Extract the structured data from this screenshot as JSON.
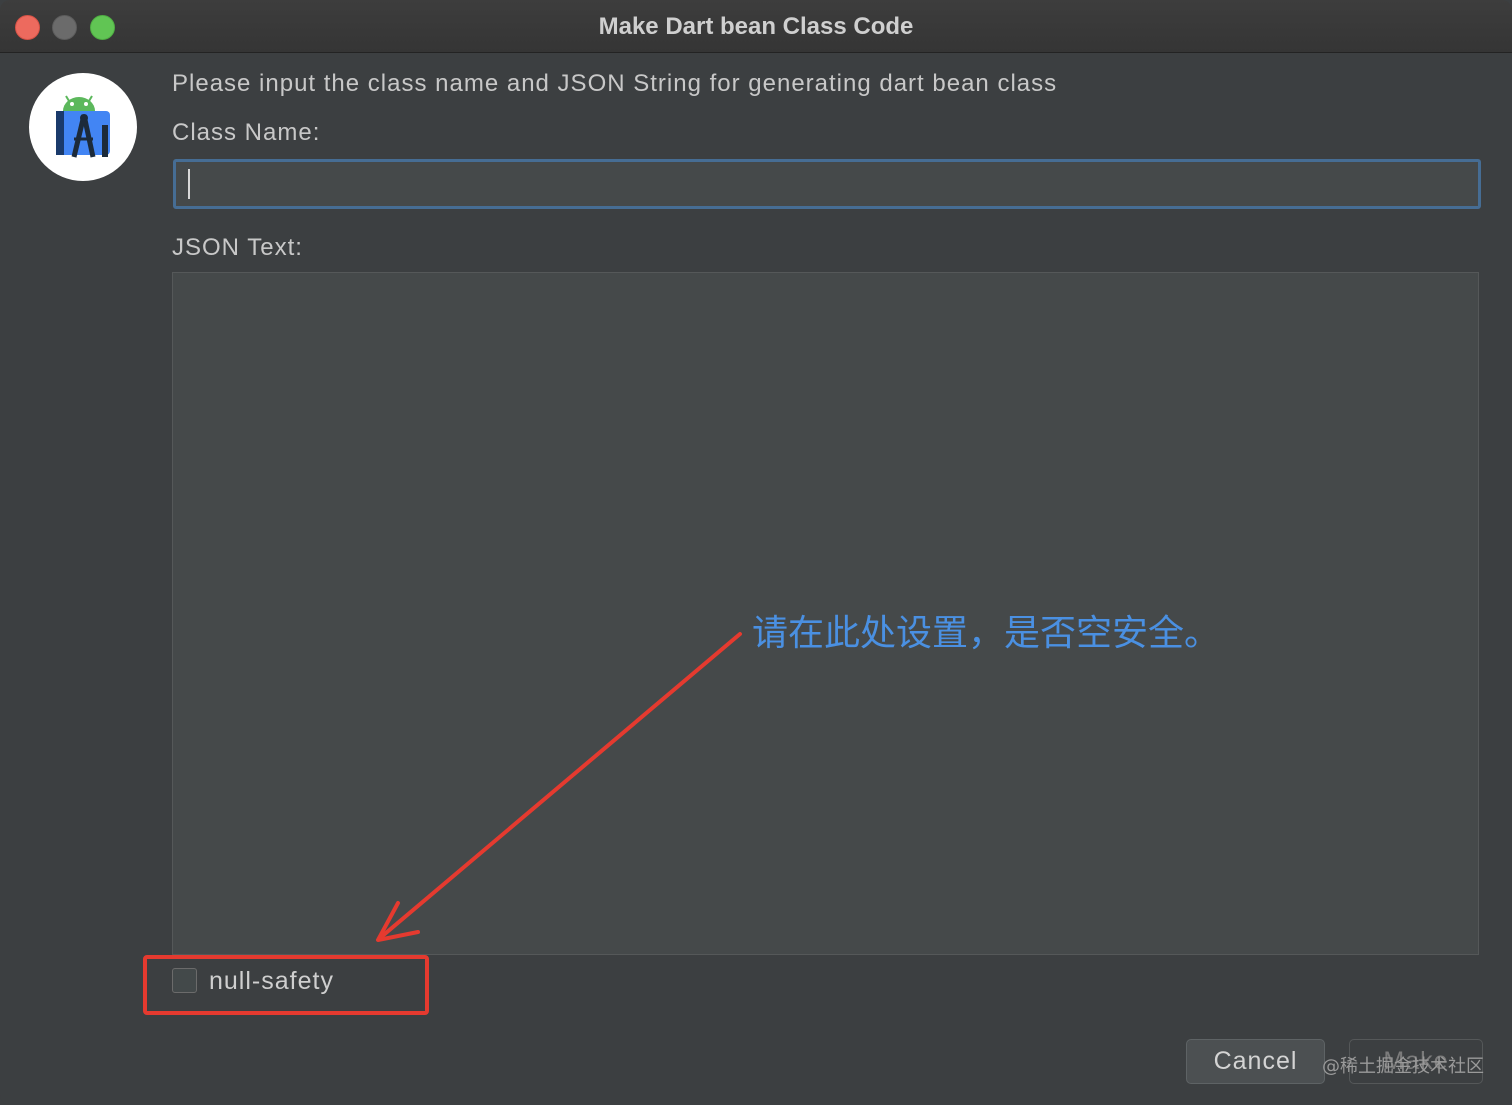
{
  "window": {
    "title": "Make Dart bean Class Code"
  },
  "app_icon": {
    "name": "android-studio-icon"
  },
  "form": {
    "prompt": "Please input the class name and JSON String for generating dart bean class",
    "class_name_label": "Class Name:",
    "class_name_value": "",
    "json_label": "JSON Text:",
    "json_value": ""
  },
  "options": {
    "null_safety_label": "null-safety",
    "null_safety_checked": false
  },
  "annotation": {
    "text": "请在此处设置，是否空安全。",
    "color": "#e53a2f",
    "text_color": "#4a90e2"
  },
  "buttons": {
    "cancel_label": "Cancel",
    "make_label": "Make"
  },
  "watermark": {
    "text": "@稀土掘金技术社区"
  }
}
